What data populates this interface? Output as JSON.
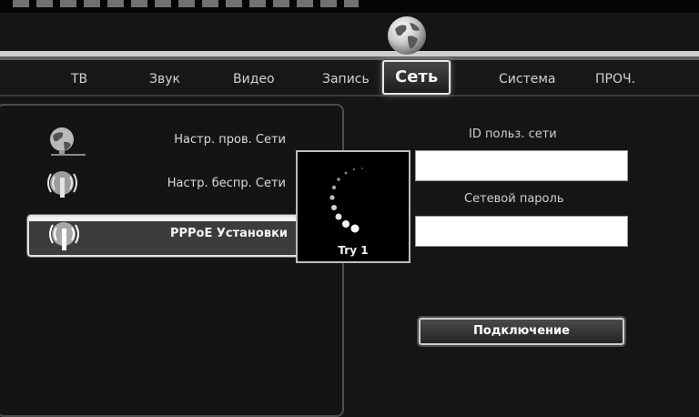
{
  "tabs": [
    {
      "label": "ТВ"
    },
    {
      "label": "Звук"
    },
    {
      "label": "Видео"
    },
    {
      "label": "Запись"
    },
    {
      "label": "Сеть"
    },
    {
      "label": "Система"
    },
    {
      "label": "ПРОЧ."
    }
  ],
  "active_tab": "Сеть",
  "menu": {
    "items": [
      {
        "label": "Настр. пров. Сети",
        "icon": "wired-network-globe-icon"
      },
      {
        "label": "Настр. беспр. Сети",
        "icon": "wireless-antenna-icon"
      },
      {
        "label": "PPPoE Установки",
        "icon": "wireless-antenna-icon"
      }
    ],
    "selected": "PPPoE Установки"
  },
  "form": {
    "user_id_label": "ID польз. сети",
    "user_id_value": "",
    "password_label": "Сетевой пароль",
    "password_value": "",
    "connect_label": "Подключение"
  },
  "popup": {
    "status_text": "Try 1"
  },
  "colors": {
    "background": "#151515",
    "highlight": "#e6e6e6",
    "input": "#ffffff"
  }
}
